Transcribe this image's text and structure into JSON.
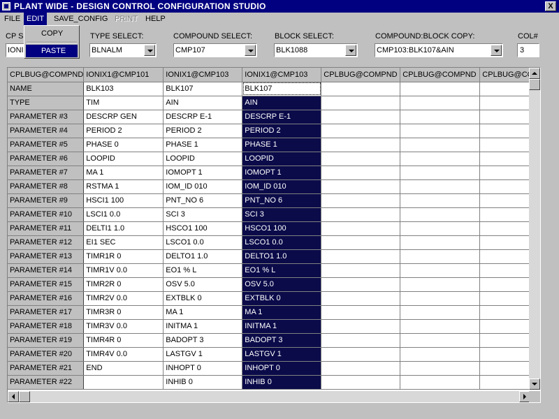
{
  "window": {
    "title": "PLANT WIDE - DESIGN CONTROL CONFIGURATION STUDIO",
    "close_glyph": "X"
  },
  "menu": {
    "file": "FILE",
    "edit": "EDIT",
    "save_config": "SAVE_CONFIG",
    "print": "PRINT",
    "help": "HELP"
  },
  "edit_menu": {
    "copy": "COPY",
    "paste": "PASTE"
  },
  "selectors": {
    "cp_label": "CP S",
    "cp_value": "IONIX",
    "type_label": "TYPE SELECT:",
    "type_value": "BLNALM",
    "compound_label": "COMPOUND SELECT:",
    "compound_value": "CMP107",
    "block_label": "BLOCK SELECT:",
    "block_value": "BLK1088",
    "copy_label": "COMPOUND:BLOCK COPY:",
    "copy_value": "CMP103:BLK107&AIN",
    "col_label": "COL#",
    "col_value": "3"
  },
  "grid": {
    "headers": [
      "CPLBUG@COMPND",
      "IONIX1@CMP101",
      "IONIX1@CMP103",
      "IONIX1@CMP103",
      "CPLBUG@COMPND",
      "CPLBUG@COMPND",
      "CPLBUG@CO"
    ],
    "rows": [
      {
        "label": "NAME",
        "c1": "BLK103",
        "c2": "BLK107",
        "c3": "BLK107"
      },
      {
        "label": "TYPE",
        "c1": "TIM",
        "c2": "AIN",
        "c3": "AIN"
      },
      {
        "label": "PARAMETER #3",
        "c1": "DESCRP GEN",
        "c2": "DESCRP E-1",
        "c3": "DESCRP E-1"
      },
      {
        "label": "PARAMETER #4",
        "c1": "PERIOD 2",
        "c2": "PERIOD 2",
        "c3": "PERIOD 2"
      },
      {
        "label": "PARAMETER #5",
        "c1": "PHASE 0",
        "c2": "PHASE 1",
        "c3": "PHASE 1"
      },
      {
        "label": "PARAMETER #6",
        "c1": "LOOPID",
        "c2": "LOOPID",
        "c3": "LOOPID"
      },
      {
        "label": "PARAMETER #7",
        "c1": "MA 1",
        "c2": "IOMOPT 1",
        "c3": "IOMOPT 1"
      },
      {
        "label": "PARAMETER #8",
        "c1": "RSTMA 1",
        "c2": "IOM_ID 010",
        "c3": "IOM_ID 010"
      },
      {
        "label": "PARAMETER #9",
        "c1": "HSCI1 100",
        "c2": "PNT_NO 6",
        "c3": "PNT_NO 6"
      },
      {
        "label": "PARAMETER #10",
        "c1": "LSCI1 0.0",
        "c2": "SCI 3",
        "c3": "SCI 3"
      },
      {
        "label": "PARAMETER #11",
        "c1": "DELTI1 1.0",
        "c2": "HSCO1 100",
        "c3": "HSCO1 100"
      },
      {
        "label": "PARAMETER #12",
        "c1": "EI1 SEC",
        "c2": "LSCO1 0.0",
        "c3": "LSCO1 0.0"
      },
      {
        "label": "PARAMETER #13",
        "c1": "TIMR1R 0",
        "c2": "DELTO1 1.0",
        "c3": "DELTO1 1.0"
      },
      {
        "label": "PARAMETER #14",
        "c1": "TIMR1V 0.0",
        "c2": "EO1 % L",
        "c3": "EO1 % L"
      },
      {
        "label": "PARAMETER #15",
        "c1": "TIMR2R 0",
        "c2": "OSV 5.0",
        "c3": "OSV 5.0"
      },
      {
        "label": "PARAMETER #16",
        "c1": "TIMR2V 0.0",
        "c2": "EXTBLK 0",
        "c3": "EXTBLK 0"
      },
      {
        "label": "PARAMETER #17",
        "c1": "TIMR3R 0",
        "c2": "MA 1",
        "c3": "MA 1"
      },
      {
        "label": "PARAMETER #18",
        "c1": "TIMR3V 0.0",
        "c2": "INITMA 1",
        "c3": "INITMA 1"
      },
      {
        "label": "PARAMETER #19",
        "c1": "TIMR4R 0",
        "c2": "BADOPT 3",
        "c3": "BADOPT 3"
      },
      {
        "label": "PARAMETER #20",
        "c1": "TIMR4V 0.0",
        "c2": "LASTGV 1",
        "c3": "LASTGV 1"
      },
      {
        "label": "PARAMETER #21",
        "c1": "END",
        "c2": "INHOPT 0",
        "c3": "INHOPT 0"
      },
      {
        "label": "PARAMETER #22",
        "c1": "",
        "c2": "INHIB 0",
        "c3": "INHIB 0"
      }
    ]
  },
  "colors": {
    "title_bar": "#000080",
    "selection": "#0b0b4a",
    "face": "#c0c0c0"
  }
}
